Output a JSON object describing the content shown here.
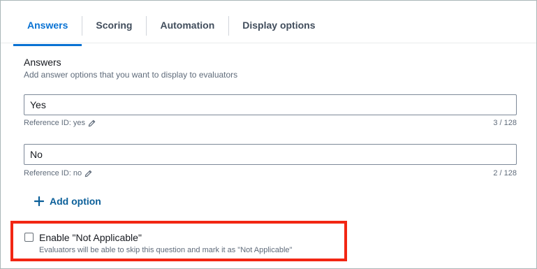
{
  "tabs": [
    {
      "label": "Answers",
      "active": true
    },
    {
      "label": "Scoring",
      "active": false
    },
    {
      "label": "Automation",
      "active": false
    },
    {
      "label": "Display options",
      "active": false
    }
  ],
  "answers": {
    "title": "Answers",
    "description": "Add answer options that you want to display to evaluators",
    "options": [
      {
        "value": "Yes",
        "reference": "Reference ID: yes",
        "count": "3 / 128"
      },
      {
        "value": "No",
        "reference": "Reference ID: no",
        "count": "2 / 128"
      }
    ],
    "add_option_label": "Add option"
  },
  "not_applicable": {
    "label": "Enable \"Not Applicable\"",
    "description": "Evaluators will be able to skip this question and mark it as \"Not Applicable\"",
    "checked": false
  },
  "colors": {
    "accent": "#0972d3",
    "link": "#0b5f99",
    "highlight": "#f22613"
  },
  "icons": {
    "edit": "pencil-icon",
    "add": "plus-icon"
  }
}
